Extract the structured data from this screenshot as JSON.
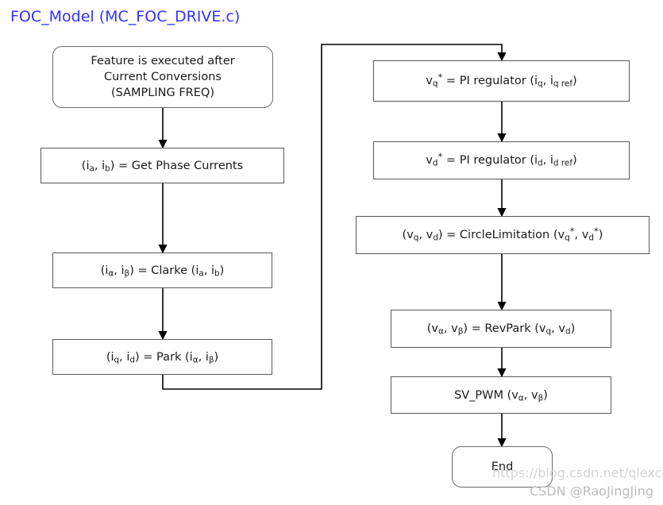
{
  "title": "FOC_Model  (MC_FOC_DRIVE.c)",
  "diagram": {
    "type": "flowchart",
    "nodes": [
      {
        "id": "start",
        "shape": "terminator",
        "lines": [
          "Feature is executed after",
          "Current  Conversions",
          "(SAMPLING FREQ)"
        ],
        "text": "Feature is executed after Current  Conversions (SAMPLING FREQ)"
      },
      {
        "id": "get-phase-currents",
        "shape": "process",
        "text": "(ia, ib) = Get Phase Currents"
      },
      {
        "id": "clarke",
        "shape": "process",
        "text": "(iα, iβ) = Clarke (ia, ib)"
      },
      {
        "id": "park",
        "shape": "process",
        "text": "(iq, id) = Park (iα, iβ)"
      },
      {
        "id": "pi-regulator-q",
        "shape": "process",
        "text": "vq* = PI regulator (iq, iq ref)"
      },
      {
        "id": "pi-regulator-d",
        "shape": "process",
        "text": "vd* = PI regulator (id, id ref)"
      },
      {
        "id": "circle-limitation",
        "shape": "process",
        "text": "(vq, vd) = CircleLimitation (vq*, vd*)"
      },
      {
        "id": "rev-park",
        "shape": "process",
        "text": "(vα, vβ) = RevPark (vq, vd)"
      },
      {
        "id": "sv-pwm",
        "shape": "process",
        "text": "SV_PWM (vα, vβ)"
      },
      {
        "id": "end",
        "shape": "terminator",
        "text": "End"
      }
    ],
    "edges": [
      {
        "from": "start",
        "to": "get-phase-currents"
      },
      {
        "from": "get-phase-currents",
        "to": "clarke"
      },
      {
        "from": "clarke",
        "to": "park"
      },
      {
        "from": "park",
        "to": "pi-regulator-q"
      },
      {
        "from": "pi-regulator-q",
        "to": "pi-regulator-d"
      },
      {
        "from": "pi-regulator-d",
        "to": "circle-limitation"
      },
      {
        "from": "circle-limitation",
        "to": "rev-park"
      },
      {
        "from": "rev-park",
        "to": "sv-pwm"
      },
      {
        "from": "sv-pwm",
        "to": "end"
      }
    ]
  },
  "colors": {
    "title": "#3333FF",
    "box_border": "#595959",
    "connector": "#000000",
    "background": "#FFFFFF",
    "watermark": "#D3D3D3"
  },
  "watermark": {
    "url": "https://blog.csdn.net/qlexcel",
    "user": "CSDN @RaoJingJing"
  }
}
